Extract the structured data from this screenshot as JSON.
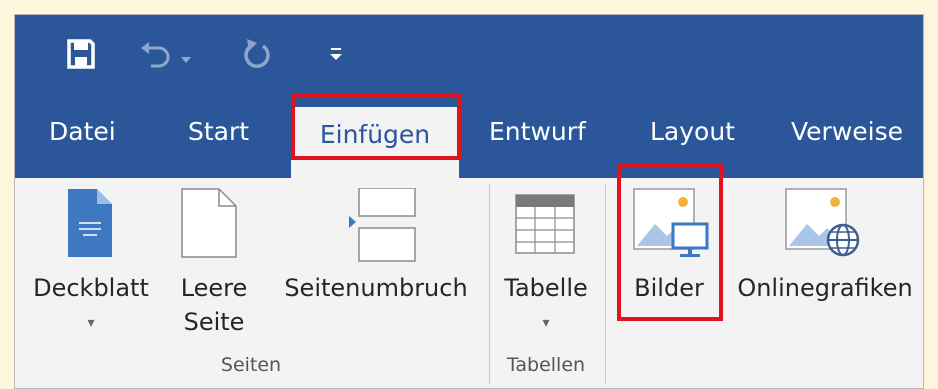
{
  "quick_access": {
    "save_icon": "save-icon",
    "undo_icon": "undo-icon",
    "redo_icon": "redo-icon",
    "customize_icon": "customize-qat-icon"
  },
  "tabs": [
    {
      "label": "Datei"
    },
    {
      "label": "Start"
    },
    {
      "label": "Einfügen",
      "active": true
    },
    {
      "label": "Entwurf"
    },
    {
      "label": "Layout"
    },
    {
      "label": "Verweise"
    }
  ],
  "ribbon": {
    "groups": [
      {
        "label": "Seiten",
        "commands": [
          {
            "label": "Deckblatt",
            "icon": "cover-page-icon",
            "dropdown": true
          },
          {
            "label": "Leere Seite",
            "icon": "blank-page-icon"
          },
          {
            "label": "Seitenumbruch",
            "icon": "page-break-icon"
          }
        ]
      },
      {
        "label": "Tabellen",
        "commands": [
          {
            "label": "Tabelle",
            "icon": "table-icon",
            "dropdown": true
          }
        ]
      },
      {
        "label": "",
        "commands": [
          {
            "label": "Bilder",
            "icon": "pictures-icon",
            "highlighted": true
          },
          {
            "label": "Onlinegrafiken",
            "icon": "online-pictures-icon"
          }
        ]
      }
    ]
  },
  "colors": {
    "titlebar": "#2b579a",
    "ribbon": "#f3f3f3",
    "highlight": "#e0141e",
    "page_background": "#fdf6dc"
  }
}
